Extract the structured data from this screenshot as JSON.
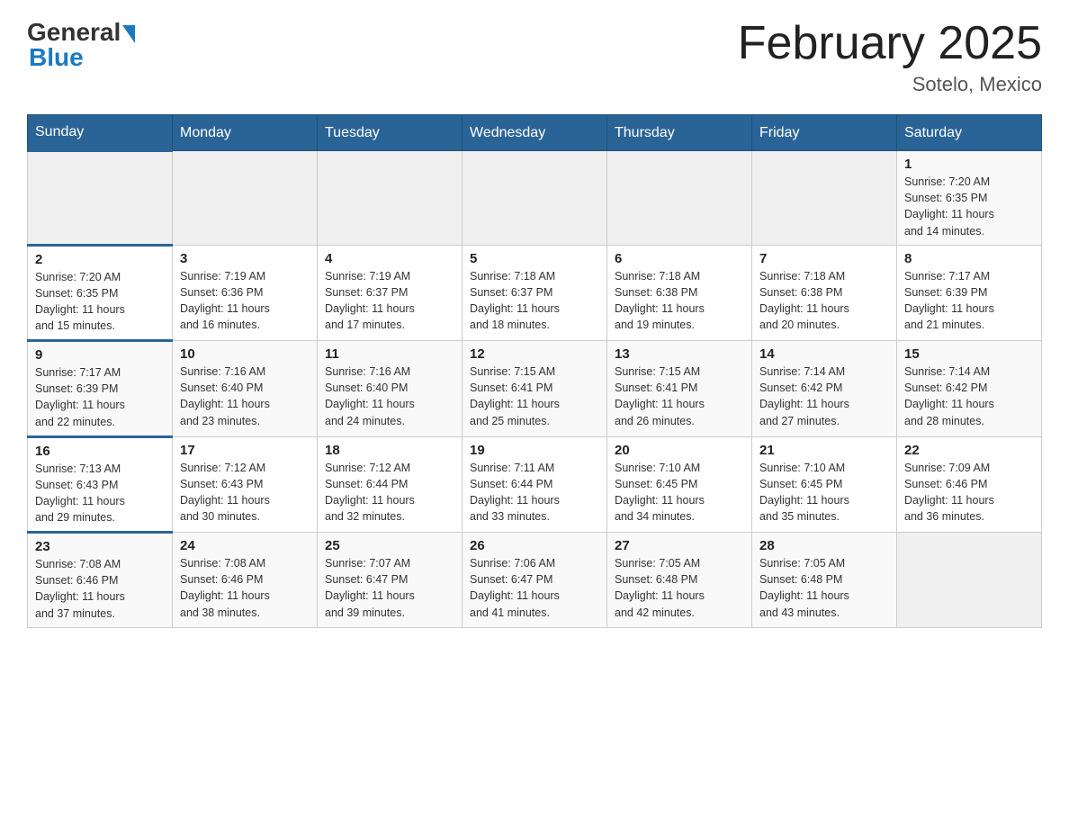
{
  "header": {
    "logo": {
      "general_text": "General",
      "blue_text": "Blue"
    },
    "title": "February 2025",
    "location": "Sotelo, Mexico"
  },
  "weekdays": [
    "Sunday",
    "Monday",
    "Tuesday",
    "Wednesday",
    "Thursday",
    "Friday",
    "Saturday"
  ],
  "weeks": [
    [
      {
        "day": "",
        "info": ""
      },
      {
        "day": "",
        "info": ""
      },
      {
        "day": "",
        "info": ""
      },
      {
        "day": "",
        "info": ""
      },
      {
        "day": "",
        "info": ""
      },
      {
        "day": "",
        "info": ""
      },
      {
        "day": "1",
        "info": "Sunrise: 7:20 AM\nSunset: 6:35 PM\nDaylight: 11 hours\nand 14 minutes."
      }
    ],
    [
      {
        "day": "2",
        "info": "Sunrise: 7:20 AM\nSunset: 6:35 PM\nDaylight: 11 hours\nand 15 minutes."
      },
      {
        "day": "3",
        "info": "Sunrise: 7:19 AM\nSunset: 6:36 PM\nDaylight: 11 hours\nand 16 minutes."
      },
      {
        "day": "4",
        "info": "Sunrise: 7:19 AM\nSunset: 6:37 PM\nDaylight: 11 hours\nand 17 minutes."
      },
      {
        "day": "5",
        "info": "Sunrise: 7:18 AM\nSunset: 6:37 PM\nDaylight: 11 hours\nand 18 minutes."
      },
      {
        "day": "6",
        "info": "Sunrise: 7:18 AM\nSunset: 6:38 PM\nDaylight: 11 hours\nand 19 minutes."
      },
      {
        "day": "7",
        "info": "Sunrise: 7:18 AM\nSunset: 6:38 PM\nDaylight: 11 hours\nand 20 minutes."
      },
      {
        "day": "8",
        "info": "Sunrise: 7:17 AM\nSunset: 6:39 PM\nDaylight: 11 hours\nand 21 minutes."
      }
    ],
    [
      {
        "day": "9",
        "info": "Sunrise: 7:17 AM\nSunset: 6:39 PM\nDaylight: 11 hours\nand 22 minutes."
      },
      {
        "day": "10",
        "info": "Sunrise: 7:16 AM\nSunset: 6:40 PM\nDaylight: 11 hours\nand 23 minutes."
      },
      {
        "day": "11",
        "info": "Sunrise: 7:16 AM\nSunset: 6:40 PM\nDaylight: 11 hours\nand 24 minutes."
      },
      {
        "day": "12",
        "info": "Sunrise: 7:15 AM\nSunset: 6:41 PM\nDaylight: 11 hours\nand 25 minutes."
      },
      {
        "day": "13",
        "info": "Sunrise: 7:15 AM\nSunset: 6:41 PM\nDaylight: 11 hours\nand 26 minutes."
      },
      {
        "day": "14",
        "info": "Sunrise: 7:14 AM\nSunset: 6:42 PM\nDaylight: 11 hours\nand 27 minutes."
      },
      {
        "day": "15",
        "info": "Sunrise: 7:14 AM\nSunset: 6:42 PM\nDaylight: 11 hours\nand 28 minutes."
      }
    ],
    [
      {
        "day": "16",
        "info": "Sunrise: 7:13 AM\nSunset: 6:43 PM\nDaylight: 11 hours\nand 29 minutes."
      },
      {
        "day": "17",
        "info": "Sunrise: 7:12 AM\nSunset: 6:43 PM\nDaylight: 11 hours\nand 30 minutes."
      },
      {
        "day": "18",
        "info": "Sunrise: 7:12 AM\nSunset: 6:44 PM\nDaylight: 11 hours\nand 32 minutes."
      },
      {
        "day": "19",
        "info": "Sunrise: 7:11 AM\nSunset: 6:44 PM\nDaylight: 11 hours\nand 33 minutes."
      },
      {
        "day": "20",
        "info": "Sunrise: 7:10 AM\nSunset: 6:45 PM\nDaylight: 11 hours\nand 34 minutes."
      },
      {
        "day": "21",
        "info": "Sunrise: 7:10 AM\nSunset: 6:45 PM\nDaylight: 11 hours\nand 35 minutes."
      },
      {
        "day": "22",
        "info": "Sunrise: 7:09 AM\nSunset: 6:46 PM\nDaylight: 11 hours\nand 36 minutes."
      }
    ],
    [
      {
        "day": "23",
        "info": "Sunrise: 7:08 AM\nSunset: 6:46 PM\nDaylight: 11 hours\nand 37 minutes."
      },
      {
        "day": "24",
        "info": "Sunrise: 7:08 AM\nSunset: 6:46 PM\nDaylight: 11 hours\nand 38 minutes."
      },
      {
        "day": "25",
        "info": "Sunrise: 7:07 AM\nSunset: 6:47 PM\nDaylight: 11 hours\nand 39 minutes."
      },
      {
        "day": "26",
        "info": "Sunrise: 7:06 AM\nSunset: 6:47 PM\nDaylight: 11 hours\nand 41 minutes."
      },
      {
        "day": "27",
        "info": "Sunrise: 7:05 AM\nSunset: 6:48 PM\nDaylight: 11 hours\nand 42 minutes."
      },
      {
        "day": "28",
        "info": "Sunrise: 7:05 AM\nSunset: 6:48 PM\nDaylight: 11 hours\nand 43 minutes."
      },
      {
        "day": "",
        "info": ""
      }
    ]
  ]
}
